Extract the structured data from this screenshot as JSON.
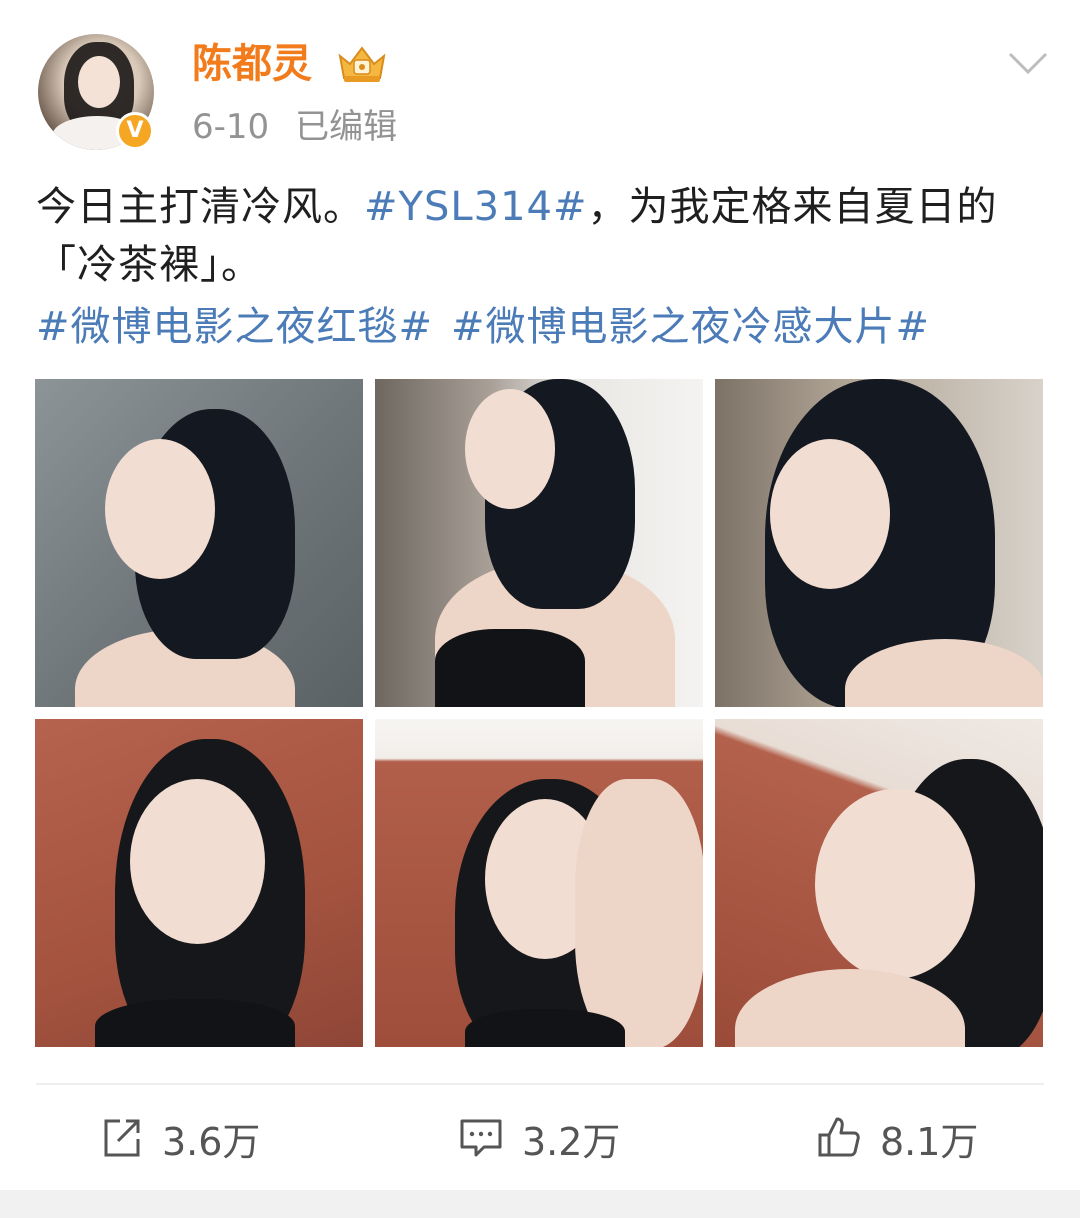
{
  "user": {
    "name": "陈都灵",
    "verified_badge": "V",
    "crown_icon": "vip-crown-icon",
    "date": "6-10",
    "edited_label": "已编辑"
  },
  "post": {
    "text_before_tag": "今日主打清冷风。",
    "inline_tag": "#YSL314#",
    "text_after_tag": "，为我定格来自夏日的「冷茶裸」。",
    "tags": [
      "#微博电影之夜红毯#",
      "#微博电影之夜冷感大片#"
    ]
  },
  "images": [
    {
      "name": "photo-1"
    },
    {
      "name": "photo-2"
    },
    {
      "name": "photo-3"
    },
    {
      "name": "photo-4"
    },
    {
      "name": "photo-5"
    },
    {
      "name": "photo-6"
    }
  ],
  "actions": {
    "share": {
      "icon": "share-icon",
      "count": "3.6万"
    },
    "comment": {
      "icon": "comment-icon",
      "count": "3.2万"
    },
    "like": {
      "icon": "thumbs-up-icon",
      "count": "8.1万"
    }
  },
  "colors": {
    "username": "#f27b1c",
    "tag": "#4b7cb8",
    "meta": "#939393",
    "verified": "#f5a623"
  }
}
